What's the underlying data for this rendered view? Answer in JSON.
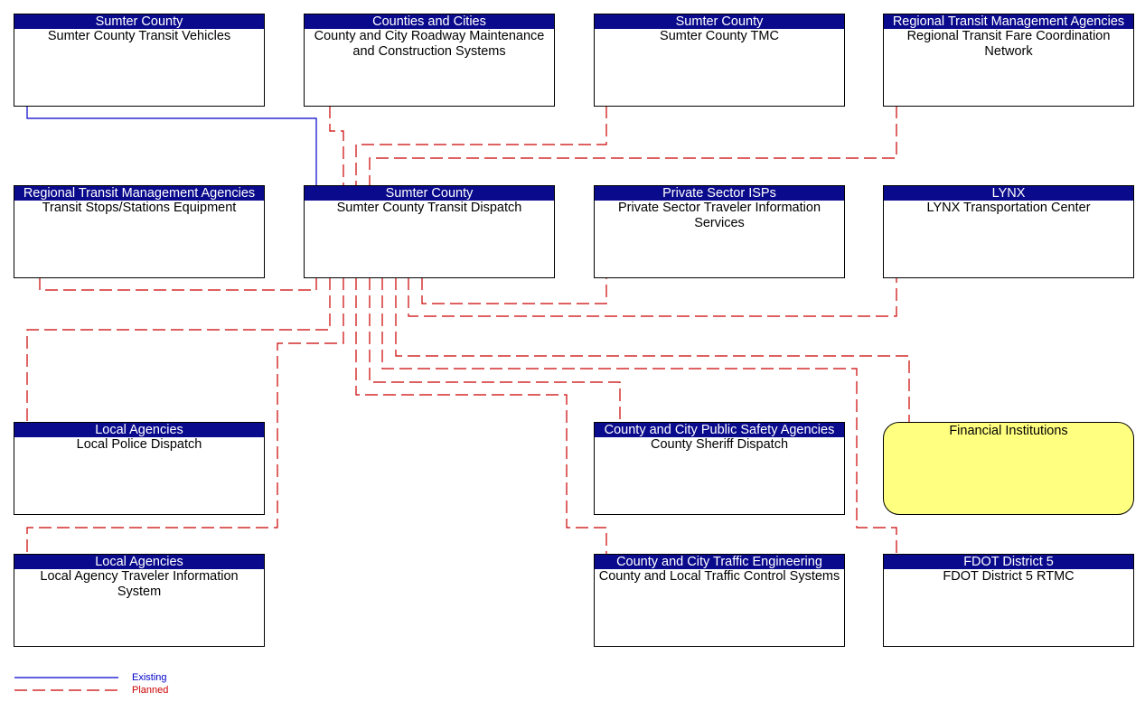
{
  "nodes": [
    {
      "id": "stv",
      "org": "Sumter County",
      "name": "Sumter County Transit Vehicles"
    },
    {
      "id": "ccrm",
      "org": "Counties and Cities",
      "name": "County and City Roadway Maintenance and Construction Systems"
    },
    {
      "id": "tmc",
      "org": "Sumter County",
      "name": "Sumter County TMC"
    },
    {
      "id": "rfc",
      "org": "Regional Transit Management Agencies",
      "name": "Regional Transit Fare Coordination Network"
    },
    {
      "id": "tss",
      "org": "Regional Transit Management Agencies",
      "name": "Transit Stops/Stations Equipment"
    },
    {
      "id": "disp",
      "org": "Sumter County",
      "name": "Sumter County Transit Dispatch"
    },
    {
      "id": "isp",
      "org": "Private Sector ISPs",
      "name": "Private Sector Traveler Information Services"
    },
    {
      "id": "lynx",
      "org": "LYNX",
      "name": "LYNX Transportation Center"
    },
    {
      "id": "lpd",
      "org": "Local Agencies",
      "name": "Local Police Dispatch"
    },
    {
      "id": "csd",
      "org": "County and City Public Safety Agencies",
      "name": "County Sheriff Dispatch"
    },
    {
      "id": "fin",
      "org": "",
      "name": "Financial Institutions"
    },
    {
      "id": "lati",
      "org": "Local Agencies",
      "name": "Local Agency Traveler Information System"
    },
    {
      "id": "cltc",
      "org": "County and City Traffic Engineering",
      "name": "County and Local Traffic Control Systems"
    },
    {
      "id": "fdot",
      "org": "FDOT District 5",
      "name": "FDOT District 5 RTMC"
    }
  ],
  "colors": {
    "existing": "#0000cc",
    "planned": "#cc0000",
    "header": "#0a0a8c",
    "financial": "#ffff80"
  },
  "legend": {
    "existing": "Existing",
    "planned": "Planned"
  }
}
